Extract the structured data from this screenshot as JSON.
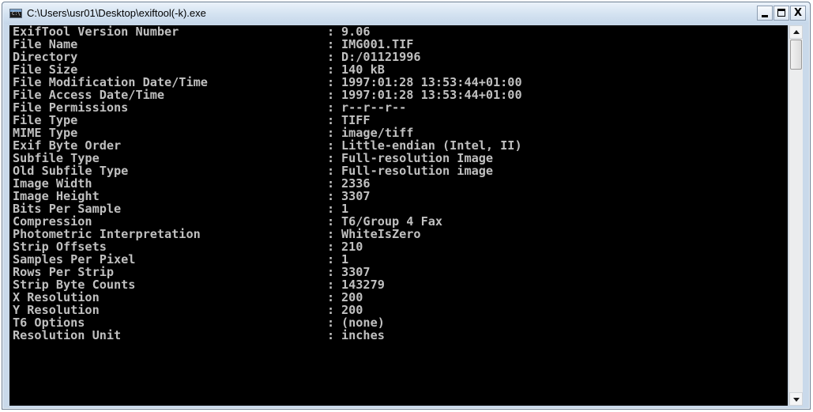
{
  "window": {
    "title": "C:\\Users\\usr01\\Desktop\\exiftool(-k).exe",
    "icon": "console-icon",
    "controls": {
      "minimize_icon": "minimize-icon",
      "maximize_icon": "maximize-icon",
      "close_label": "X"
    }
  },
  "console": {
    "separator": ":",
    "text_color": "#c0c0c0",
    "background_color": "#000000",
    "rows": [
      {
        "label": "ExifTool Version Number",
        "value": "9.06"
      },
      {
        "label": "File Name",
        "value": "IMG001.TIF"
      },
      {
        "label": "Directory",
        "value": "D:/01121996"
      },
      {
        "label": "File Size",
        "value": "140 kB"
      },
      {
        "label": "File Modification Date/Time",
        "value": "1997:01:28 13:53:44+01:00"
      },
      {
        "label": "File Access Date/Time",
        "value": "1997:01:28 13:53:44+01:00"
      },
      {
        "label": "File Permissions",
        "value": "r--r--r--"
      },
      {
        "label": "File Type",
        "value": "TIFF"
      },
      {
        "label": "MIME Type",
        "value": "image/tiff"
      },
      {
        "label": "Exif Byte Order",
        "value": "Little-endian (Intel, II)"
      },
      {
        "label": "Subfile Type",
        "value": "Full-resolution Image"
      },
      {
        "label": "Old Subfile Type",
        "value": "Full-resolution image"
      },
      {
        "label": "Image Width",
        "value": "2336"
      },
      {
        "label": "Image Height",
        "value": "3307"
      },
      {
        "label": "Bits Per Sample",
        "value": "1"
      },
      {
        "label": "Compression",
        "value": "T6/Group 4 Fax"
      },
      {
        "label": "Photometric Interpretation",
        "value": "WhiteIsZero"
      },
      {
        "label": "Strip Offsets",
        "value": "210"
      },
      {
        "label": "Samples Per Pixel",
        "value": "1"
      },
      {
        "label": "Rows Per Strip",
        "value": "3307"
      },
      {
        "label": "Strip Byte Counts",
        "value": "143279"
      },
      {
        "label": "X Resolution",
        "value": "200"
      },
      {
        "label": "Y Resolution",
        "value": "200"
      },
      {
        "label": "T6 Options",
        "value": "(none)"
      },
      {
        "label": "Resolution Unit",
        "value": "inches"
      }
    ]
  },
  "scrollbar": {
    "up_icon": "scroll-up-arrow-icon",
    "down_icon": "scroll-down-arrow-icon"
  }
}
